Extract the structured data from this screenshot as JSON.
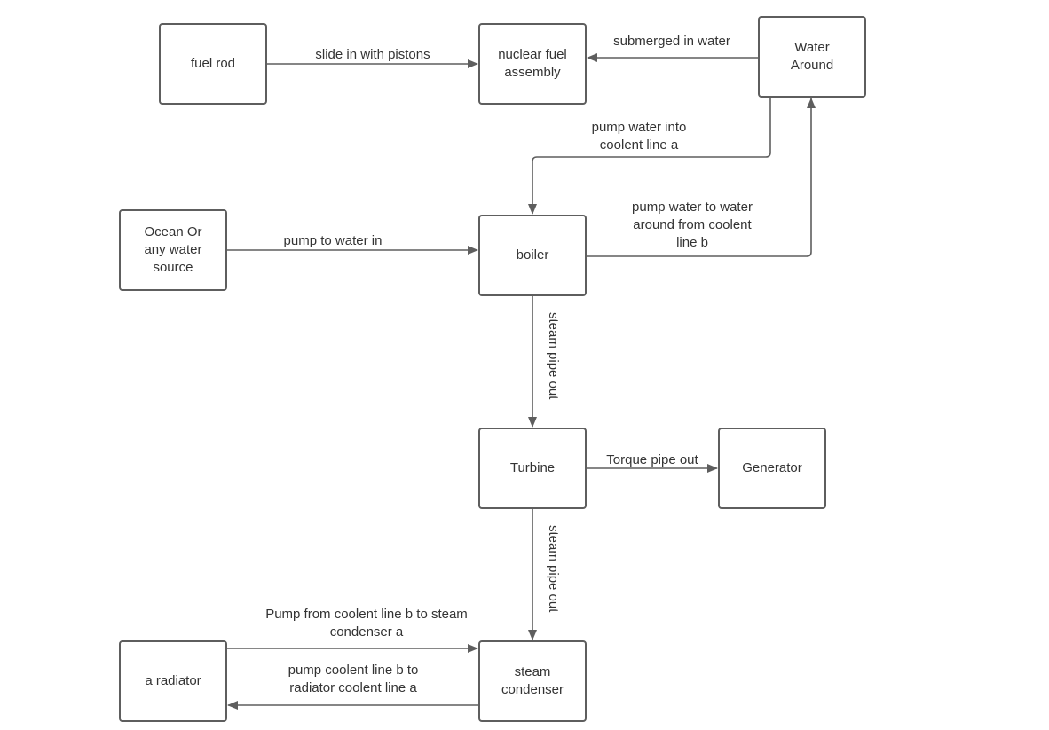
{
  "diagram": {
    "nodes": {
      "fuel_rod": "fuel rod",
      "nuclear_fuel_assembly": "nuclear  fuel\nassembly",
      "water_around": "Water\nAround",
      "ocean": "Ocean Or\nany water\nsource",
      "boiler": "boiler",
      "turbine": "Turbine",
      "generator": "Generator",
      "radiator": "a radiator",
      "steam_condenser": "steam\ncondenser"
    },
    "edges": {
      "slide_in": "slide in with pistons",
      "submerged": "submerged in water",
      "pump_into_a": "pump water into\ncoolent line a",
      "pump_to_water_in": "pump to water in",
      "pump_to_around_b": "pump water to water\naround from coolent\nline b",
      "steam_out_1": "steam pipe out",
      "torque_out": "Torque pipe out",
      "steam_out_2": "steam pipe out",
      "pump_b_to_condenser": "Pump from coolent line b to steam\ncondenser a",
      "pump_b_to_radiator": "pump coolent line b to\nradiator coolent line a"
    },
    "colors": {
      "stroke": "#5e5e5e",
      "text": "#333333"
    }
  }
}
